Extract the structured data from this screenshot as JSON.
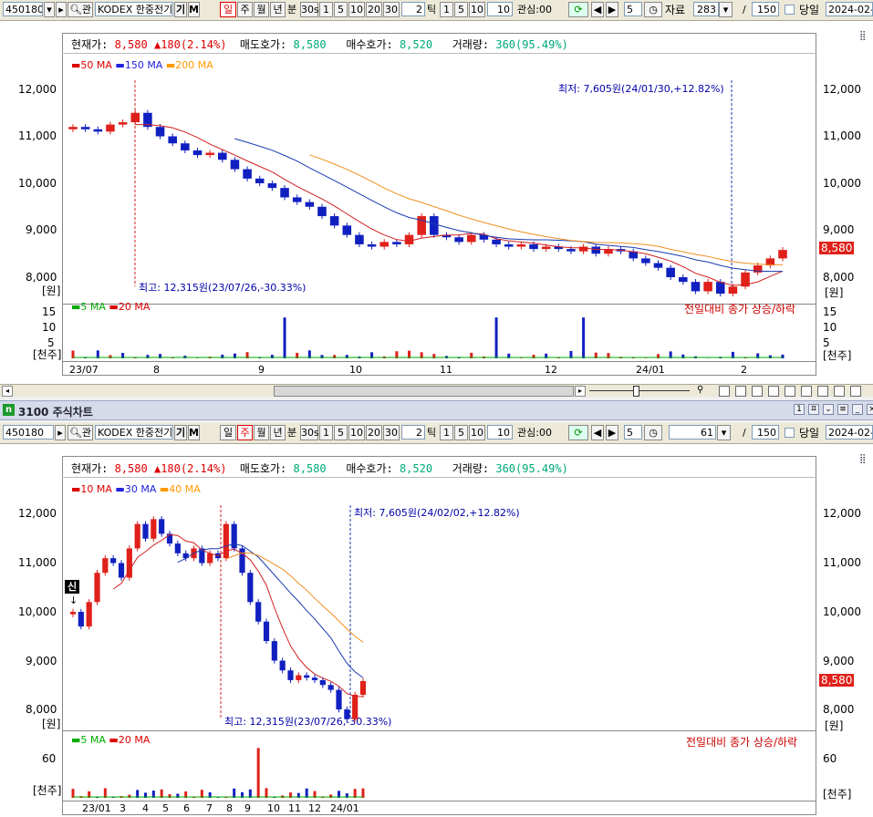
{
  "toolbar1": {
    "code": "450180",
    "name": "KODEX 한중전기",
    "gi": "기",
    "m": "M",
    "periods": [
      "일",
      "주",
      "월",
      "년"
    ],
    "bun": "분",
    "sec": "30s",
    "minutes": [
      "1",
      "5",
      "10",
      "20",
      "30"
    ],
    "tick_val": "2",
    "tick_label": "틱",
    "tick_opts": [
      "1",
      "5",
      "10"
    ],
    "tick_field": "10",
    "interest": "관심:00",
    "step": "5",
    "data_label": "자료",
    "data_count": "283",
    "slash": "/",
    "total": "150",
    "today_label": "당일",
    "date": "2024-02-"
  },
  "toolbar2": {
    "code": "450180",
    "name": "KODEX 한중전기",
    "gi": "기",
    "m": "M",
    "periods": [
      "일",
      "주",
      "월",
      "년"
    ],
    "bun": "분",
    "sec": "30s",
    "minutes": [
      "1",
      "5",
      "10",
      "20",
      "30"
    ],
    "tick_val": "2",
    "tick_label": "틱",
    "tick_opts": [
      "1",
      "5",
      "10"
    ],
    "tick_field": "10",
    "interest": "관심:00",
    "step": "5",
    "data_label": "자료",
    "data_count": "61",
    "slash": "/",
    "total": "150",
    "today_label": "당일",
    "date": "2024-02-"
  },
  "window2_title": "3100 주식차트",
  "info": {
    "cur_label": "현재가:",
    "cur_val": "8,580",
    "chg": "180(2.14%)",
    "ask_label": "매도호가:",
    "ask_val": "8,580",
    "bid_label": "매수호가:",
    "bid_val": "8,520",
    "vol_label": "거래량:",
    "vol_val": "360(95.49%)"
  },
  "chart1": {
    "legend": [
      "50 MA",
      "150 MA",
      "200 MA"
    ],
    "low_note": "최저: 7,605원(24/01/30,+12.82%)",
    "high_note": "최고: 12,315원(23/07/26,-30.33%)",
    "unit": "[원]",
    "price_box": "8,580",
    "yticks": [
      "12,000",
      "11,000",
      "10,000",
      "9,000",
      "8,000"
    ],
    "vol_legend": [
      "5 MA",
      "20 MA"
    ],
    "vol_note": "전일대비 종가 상승/하락",
    "vol_unit": "[천주]",
    "vol_ticks": [
      "15",
      "10",
      "5"
    ],
    "xticks": [
      "23/07",
      "8",
      "9",
      "10",
      "11",
      "12",
      "24/01",
      "2"
    ]
  },
  "chart2": {
    "legend": [
      "10 MA",
      "30 MA",
      "40 MA"
    ],
    "low_note": "최저: 7,605원(24/02/02,+12.82%)",
    "high_note": "최고: 12,315원(23/07/26,-30.33%)",
    "unit": "[원]",
    "price_box": "8,580",
    "sin": "신",
    "yticks": [
      "12,000",
      "11,000",
      "10,000",
      "9,000",
      "8,000"
    ],
    "vol_legend": [
      "5 MA",
      "20 MA"
    ],
    "vol_note": "전일대비 종가 상승/하락",
    "vol_unit": "[천주]",
    "vol_ticks": [
      "60"
    ],
    "xticks": [
      "23/01",
      "3",
      "4",
      "5",
      "6",
      "7",
      "8",
      "9",
      "10",
      "11",
      "12",
      "24/01"
    ]
  },
  "chart_data": [
    {
      "type": "candlestick",
      "title": "",
      "series": [
        {
          "name": "50 MA"
        },
        {
          "name": "150 MA"
        },
        {
          "name": "200 MA"
        }
      ],
      "ylim": [
        7500,
        12400
      ],
      "x": [
        "23/07",
        "8",
        "9",
        "10",
        "11",
        "12",
        "24/01",
        "2"
      ],
      "close": [
        11200,
        11150,
        11100,
        11250,
        11300,
        11500,
        11200,
        11000,
        10850,
        10700,
        10600,
        10650,
        10500,
        10300,
        10100,
        10000,
        9900,
        9700,
        9600,
        9500,
        9300,
        9100,
        8900,
        8700,
        8650,
        8750,
        8700,
        8900,
        9300,
        8900,
        8850,
        8750,
        8900,
        8800,
        8700,
        8650,
        8700,
        8600,
        8650,
        8600,
        8550,
        8650,
        8500,
        8600,
        8550,
        8400,
        8300,
        8200,
        8000,
        7900,
        7700,
        7900,
        7650,
        7800,
        8100,
        8250,
        8400,
        8580
      ]
    },
    {
      "type": "candlestick",
      "title": "",
      "series": [
        {
          "name": "10 MA"
        },
        {
          "name": "30 MA"
        },
        {
          "name": "40 MA"
        }
      ],
      "ylim": [
        7500,
        12400
      ],
      "x": [
        "23/01",
        "3",
        "4",
        "5",
        "6",
        "7",
        "8",
        "9",
        "10",
        "11",
        "12",
        "24/01"
      ],
      "close": [
        10000,
        9700,
        10200,
        10800,
        11100,
        11000,
        10700,
        11300,
        11800,
        11500,
        11900,
        11600,
        11400,
        11200,
        11100,
        11300,
        11000,
        11200,
        11100,
        11800,
        11300,
        10800,
        10200,
        9800,
        9400,
        9000,
        8800,
        8600,
        8700,
        8650,
        8600,
        8500,
        8400,
        8000,
        7800,
        8300,
        8580
      ]
    }
  ]
}
